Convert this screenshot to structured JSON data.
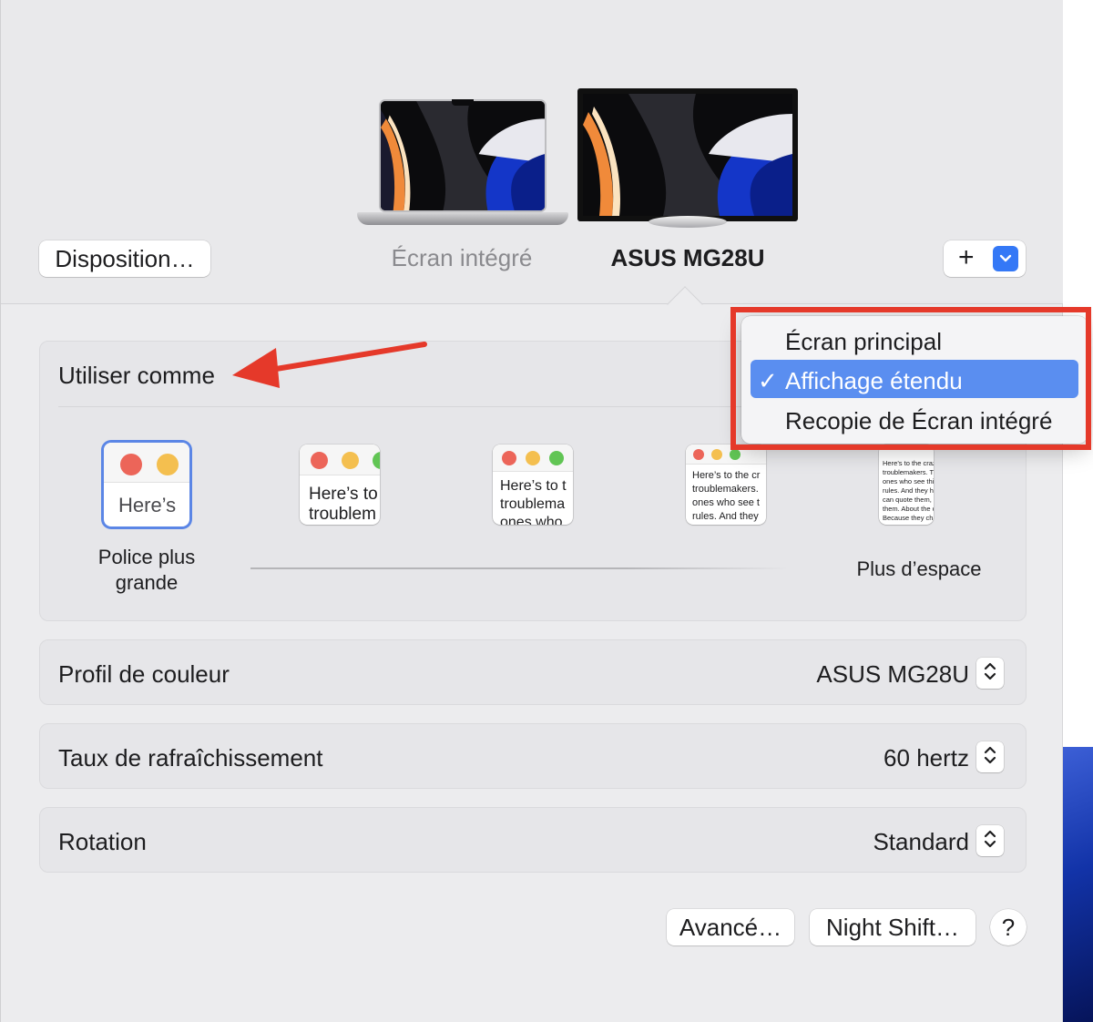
{
  "toolbar": {
    "arrangement_label": "Disposition…",
    "add_label": "+",
    "add_menu_chevron": "chevron-down-icon"
  },
  "displays": [
    {
      "label": "Écran intégré",
      "icon": "laptop-icon",
      "selected": false
    },
    {
      "label": "ASUS MG28U",
      "icon": "monitor-icon",
      "selected": true
    }
  ],
  "use_as": {
    "label": "Utiliser comme",
    "menu": {
      "items": [
        {
          "label": "Écran principal",
          "selected": false
        },
        {
          "label": "Affichage étendu",
          "selected": true,
          "check": "✓"
        },
        {
          "label": "Recopie de Écran intégré",
          "selected": false
        }
      ]
    }
  },
  "resolution": {
    "left_caption_line1": "Police plus",
    "left_caption_line2": "grande",
    "right_caption": "Plus d’espace",
    "thumbs": [
      {
        "text": "Here’s",
        "selected": true
      },
      {
        "text": "Here’s to\ntroublem",
        "selected": false
      },
      {
        "text": "Here’s to t\ntroublema\nones who",
        "selected": false
      },
      {
        "text": "Here’s to the cr\ntroublemakers.\nones who see t\nrules. And they",
        "selected": false
      },
      {
        "text": "Here’s to the crazy one\ntroublemakers. The rou\nones who see things dif\nrules. And they have no\ncan quote them, disagr\nthem. About the only th\nBecause they change th",
        "selected": false
      }
    ]
  },
  "color_profile": {
    "label": "Profil de couleur",
    "value": "ASUS MG28U"
  },
  "refresh_rate": {
    "label": "Taux de rafraîchissement",
    "value": "60 hertz"
  },
  "rotation": {
    "label": "Rotation",
    "value": "Standard"
  },
  "footer": {
    "advanced_label": "Avancé…",
    "night_shift_label": "Night Shift…",
    "help_label": "?"
  },
  "colors": {
    "accent": "#3478f6",
    "menu_selected": "#5a8ef0",
    "annotation_red": "#e5392a",
    "traffic_red": "#ec6559",
    "traffic_yellow": "#f4bf4f",
    "traffic_green": "#61c554"
  }
}
